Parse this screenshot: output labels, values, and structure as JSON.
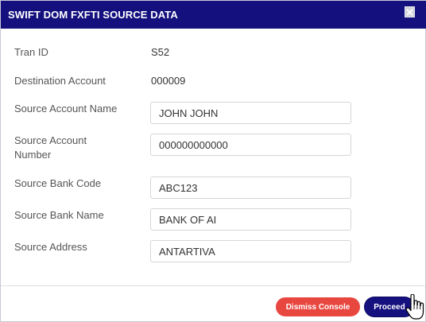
{
  "dialog": {
    "title": "SWIFT DOM FXFTI SOURCE DATA"
  },
  "fields": {
    "tran_id": {
      "label": "Tran ID",
      "value": "S52"
    },
    "destination_account": {
      "label": "Destination Account",
      "value": "000009"
    },
    "source_account_name": {
      "label": "Source Account Name",
      "value": "JOHN JOHN"
    },
    "source_account_number": {
      "label_line1": "Source Account",
      "label_line2": "Number",
      "value": "000000000000"
    },
    "source_bank_code": {
      "label": "Source Bank Code",
      "value": "ABC123"
    },
    "source_bank_name": {
      "label": "Source Bank Name",
      "value": "BANK OF AI"
    },
    "source_address": {
      "label": "Source Address",
      "value": "ANTARTIVA"
    }
  },
  "footer": {
    "dismiss_label": "Dismiss Console",
    "proceed_label": "Proceed"
  },
  "icons": {
    "close": "close-icon",
    "cursor": "hand-pointer-cursor-icon"
  },
  "colors": {
    "header_bg": "#14117e",
    "dismiss_bg": "#e84740",
    "proceed_bg": "#15117f"
  }
}
